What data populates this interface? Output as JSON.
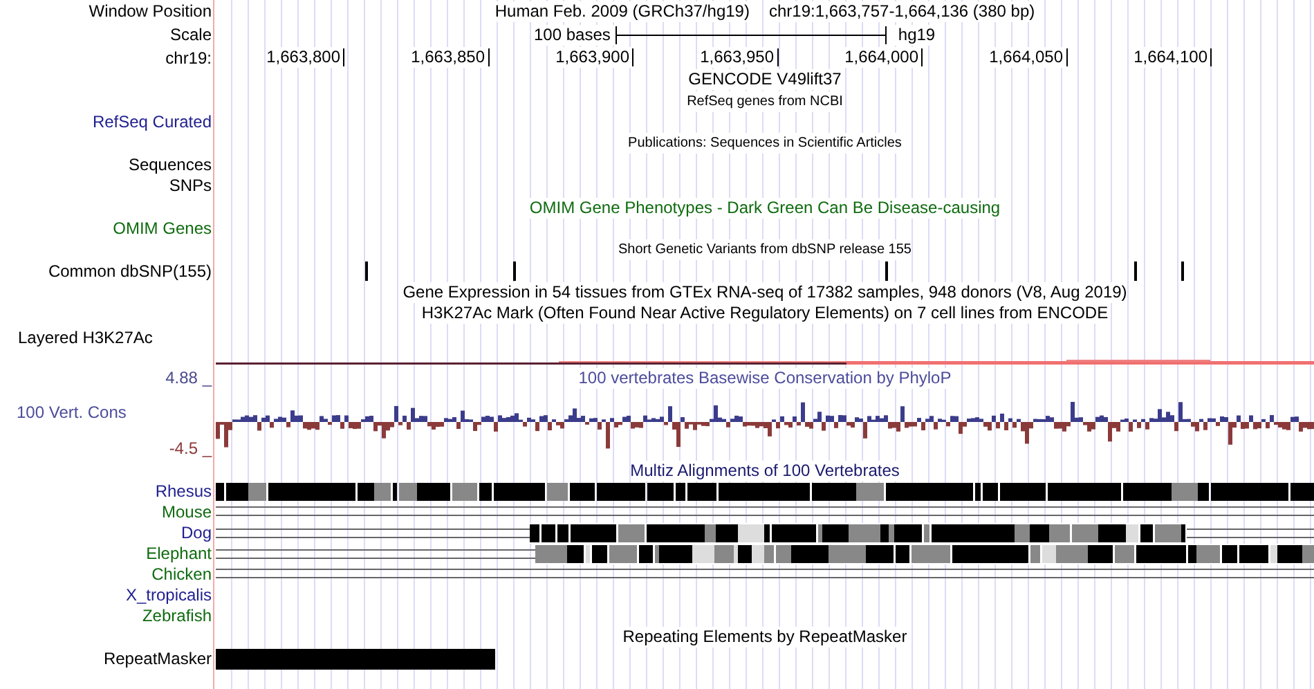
{
  "window_position": {
    "label": "Window Position",
    "assembly": "Human Feb. 2009 (GRCh37/hg19)",
    "region": "chr19:1,663,757-1,664,136 (380 bp)"
  },
  "scale": {
    "label": "Scale",
    "length": "100 bases",
    "assembly": "hg19"
  },
  "ruler": {
    "label": "chr19:",
    "ticks": [
      "1,663,800",
      "1,663,850",
      "1,663,900",
      "1,663,950",
      "1,664,000",
      "1,664,050",
      "1,664,100"
    ]
  },
  "tracks": [
    {
      "kind": "text",
      "title": {
        "text": "GENCODE V49lift37",
        "kind": "large",
        "color": "#000000"
      }
    },
    {
      "kind": "text",
      "title": {
        "text": "RefSeq genes from NCBI",
        "kind": "small",
        "color": "#000000"
      }
    },
    {
      "kind": "text",
      "label": {
        "text": "RefSeq Curated",
        "color": "#1f1f8f"
      }
    },
    {
      "kind": "text",
      "title": {
        "text": "Publications: Sequences in Scientific Articles",
        "kind": "small",
        "color": "#000000"
      }
    },
    {
      "kind": "text",
      "label": {
        "text": "Sequences",
        "color": "#000000"
      }
    },
    {
      "kind": "text",
      "label": {
        "text": "SNPs",
        "color": "#000000"
      }
    },
    {
      "kind": "text",
      "title": {
        "text": "OMIM Gene Phenotypes - Dark Green Can Be Disease-causing",
        "kind": "large",
        "color": "#0f6b0f"
      }
    },
    {
      "kind": "text",
      "label": {
        "text": "OMIM Genes",
        "color": "#0f6b0f"
      }
    },
    {
      "kind": "text",
      "title": {
        "text": "Short Genetic Variants from dbSNP release 155",
        "kind": "small",
        "color": "#000000"
      }
    },
    {
      "kind": "snps",
      "label": {
        "text": "Common dbSNP(155)",
        "color": "#000000"
      }
    },
    {
      "kind": "text",
      "title": {
        "text": "Gene Expression in 54 tissues from GTEx RNA-seq of 17382 samples, 948 donors (V8, Aug 2019)",
        "kind": "large",
        "color": "#000000"
      }
    },
    {
      "kind": "text",
      "title": {
        "text": "H3K27Ac Mark (Often Found Near Active Regulatory Elements) on 7 cell lines from ENCODE",
        "kind": "large",
        "color": "#000000"
      }
    },
    {
      "kind": "layered",
      "label": {
        "text": "Layered H3K27Ac",
        "color": "#000000"
      }
    }
  ],
  "conservation": {
    "title": "100 vertebrates Basewise Conservation by PhyloP",
    "label": "100 Vert. Cons",
    "max": "4.88 _",
    "min": "-4.5 _"
  },
  "multiz": {
    "title": "Multiz Alignments of 100 Vertebrates",
    "species": [
      {
        "name": "Rhesus",
        "color": "#1f1f8f",
        "kind": "full"
      },
      {
        "name": "Mouse",
        "color": "#0f6b0f",
        "kind": "lines"
      },
      {
        "name": "Dog",
        "color": "#1f1f8f",
        "kind": "partial"
      },
      {
        "name": "Elephant",
        "color": "#0f6b0f",
        "kind": "partial"
      },
      {
        "name": "Chicken",
        "color": "#0f6b0f",
        "kind": "lines"
      },
      {
        "name": "X_tropicalis",
        "color": "#1f1f8f",
        "kind": "empty"
      },
      {
        "name": "Zebrafish",
        "color": "#0f6b0f",
        "kind": "empty"
      }
    ]
  },
  "repeats": {
    "title": "Repeating Elements by RepeatMasker",
    "label": "RepeatMasker"
  }
}
